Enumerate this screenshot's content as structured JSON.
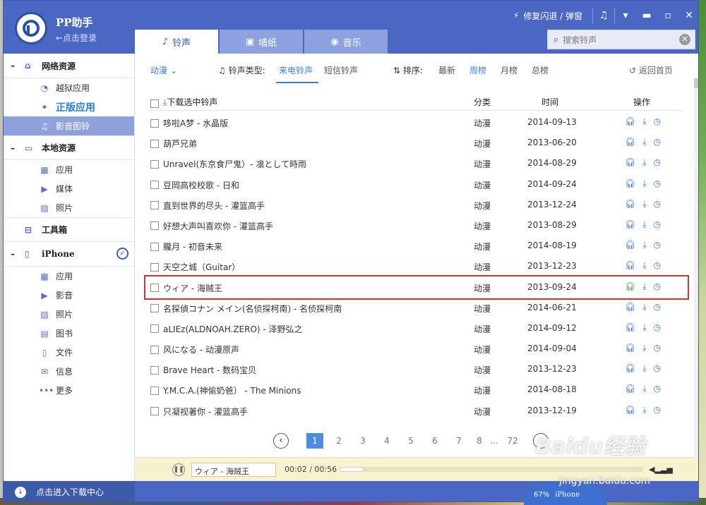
{
  "app": {
    "name": "PP助手",
    "login": "←点击登录"
  },
  "titlebar": {
    "fix_label": "修复闪退 / 弹窗"
  },
  "tabs": [
    {
      "label": "铃声",
      "icon": "bell-icon"
    },
    {
      "label": "墙纸",
      "icon": "image-icon"
    },
    {
      "label": "音乐",
      "icon": "disc-icon"
    }
  ],
  "search": {
    "placeholder": "搜索铃声"
  },
  "sidebar": {
    "network": {
      "label": "网络资源",
      "items": [
        {
          "label": "越狱应用"
        },
        {
          "label": "正版应用"
        },
        {
          "label": "影音图铃"
        }
      ]
    },
    "local": {
      "label": "本地资源",
      "items": [
        {
          "label": "应用"
        },
        {
          "label": "媒体"
        },
        {
          "label": "照片"
        }
      ]
    },
    "toolbox": {
      "label": "工具箱"
    },
    "iphone": {
      "label": "iPhone",
      "items": [
        {
          "label": "应用"
        },
        {
          "label": "影音"
        },
        {
          "label": "照片"
        },
        {
          "label": "图书"
        },
        {
          "label": "文件"
        },
        {
          "label": "信息"
        },
        {
          "label": "更多"
        }
      ]
    },
    "download_center": "点击进入下载中心"
  },
  "filter": {
    "category": "动漫",
    "type_label": "铃声类型:",
    "type_options": [
      "来电铃声",
      "短信铃声"
    ],
    "sort_label": "排序:",
    "sort_options": [
      "最新",
      "周榜",
      "月榜",
      "总榜"
    ],
    "home": "返回首页"
  },
  "table": {
    "header": {
      "select": "下载选中铃声",
      "category": "分类",
      "time": "时间",
      "ops": "操作"
    },
    "rows": [
      {
        "name": "哆啦A梦 - 水晶版",
        "category": "动漫",
        "time": "2014-09-13"
      },
      {
        "name": "葫芦兄弟",
        "category": "动漫",
        "time": "2013-06-20"
      },
      {
        "name": "Unravel(东京食尸鬼）- 凛として時雨",
        "category": "动漫",
        "time": "2014-08-29"
      },
      {
        "name": "豆岡高校校歌 - 日和",
        "category": "动漫",
        "time": "2014-09-24"
      },
      {
        "name": "直到世界的尽头 - 灌篮高手",
        "category": "动漫",
        "time": "2013-12-24"
      },
      {
        "name": "好想大声叫喜欢你 - 灌篮高手",
        "category": "动漫",
        "time": "2013-08-29"
      },
      {
        "name": "朧月 - 初音未来",
        "category": "动漫",
        "time": "2014-08-19"
      },
      {
        "name": "天空之城（Guitar）",
        "category": "动漫",
        "time": "2013-12-23"
      },
      {
        "name": "ウィア - 海贼王",
        "category": "动漫",
        "time": "2013-09-24"
      },
      {
        "name": "名探偵コナン メイン(名侦探柯南) - 名侦探柯南",
        "category": "动漫",
        "time": "2014-06-21"
      },
      {
        "name": "aLIEz(ALDNOAH.ZERO) - 泽野弘之",
        "category": "动漫",
        "time": "2014-09-12"
      },
      {
        "name": "风になる - 动漫原声",
        "category": "动漫",
        "time": "2014-09-04"
      },
      {
        "name": "Brave Heart - 数码宝贝",
        "category": "动漫",
        "time": "2013-12-23"
      },
      {
        "name": "Y.M.C.A.(神偷奶爸） - The Minions",
        "category": "动漫",
        "time": "2014-08-18"
      },
      {
        "name": "只凝视著你 - 灌篮高手",
        "category": "动漫",
        "time": "2013-12-19"
      }
    ]
  },
  "pager": {
    "pages": [
      "1",
      "2",
      "3",
      "4",
      "5",
      "6",
      "7",
      "8"
    ],
    "ellipsis": "...",
    "last": "72",
    "current": 1
  },
  "player": {
    "now_playing": "ウィア - 海贼王",
    "time": "00:02 / 00:56",
    "progress": 0.04
  },
  "badge": {
    "percent": "67%",
    "device": "iPhone"
  },
  "watermark": {
    "line1": "Baidu经验",
    "line2": "jingyan.baidu.com"
  }
}
